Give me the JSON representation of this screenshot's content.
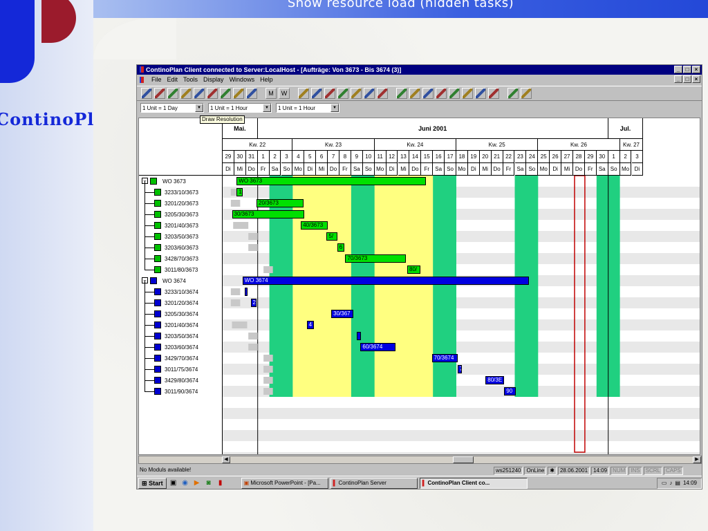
{
  "slide": {
    "title": "Show resource load (hidden tasks)",
    "logo_text": "ContinoPlan"
  },
  "window": {
    "title": "ContinoPlan Client connected to Server:LocalHost - [Aufträge: Von 3673 - Bis 3674 (3)]",
    "controls": [
      "_",
      "□",
      "×"
    ]
  },
  "menu": [
    "File",
    "Edit",
    "Tools",
    "Display",
    "Windows",
    "Help"
  ],
  "toolbar_icons": [
    "print-icon",
    "report-icon",
    "person-icon",
    "open-icon",
    "save-icon",
    "copy-icon",
    "print-preview-icon",
    "save2-icon",
    "info-icon",
    "M",
    "W",
    "gantt1-icon",
    "gantt2-icon",
    "gantt3-icon",
    "link-icon",
    "unlink-icon",
    "folder-icon",
    "move-icon",
    "shift-icon",
    "view1-icon",
    "view2-icon",
    "view3-icon",
    "edit-icon",
    "chart-icon",
    "props-icon",
    "pen-icon",
    "zoom-in-icon",
    "zoom-out-icon"
  ],
  "combos": [
    {
      "value": "1 Unit = 1 Day"
    },
    {
      "value": "1 Unit = 1 Hour"
    },
    {
      "value": "1 Unit = 1 Hour"
    }
  ],
  "tooltip": "Draw Resolution",
  "timeline": {
    "months": [
      {
        "label": "Mai."
      },
      {
        "label": "Juni 2001"
      },
      {
        "label": "Jul."
      }
    ],
    "weeks": [
      "Kw. 22",
      "Kw. 23",
      "Kw. 24",
      "Kw. 25",
      "Kw. 26",
      "Kw. 27"
    ],
    "days": [
      "29",
      "30",
      "31",
      "1",
      "2",
      "3",
      "4",
      "5",
      "6",
      "7",
      "8",
      "9",
      "10",
      "11",
      "12",
      "13",
      "14",
      "15",
      "16",
      "17",
      "18",
      "19",
      "20",
      "21",
      "22",
      "23",
      "24",
      "25",
      "26",
      "27",
      "28",
      "29",
      "30",
      "1",
      "2",
      "3"
    ],
    "weekdays": [
      "Di",
      "Mi",
      "Do",
      "Fr",
      "Sa",
      "So",
      "Mo",
      "Di",
      "Mi",
      "Do",
      "Fr",
      "Sa",
      "So",
      "Mo",
      "Di",
      "Mi",
      "Do",
      "Fr",
      "Sa",
      "So",
      "Mo",
      "Di",
      "Mi",
      "Do",
      "Fr",
      "Sa",
      "So",
      "Mo",
      "Di",
      "Mi",
      "Do",
      "Fr",
      "Sa",
      "So",
      "Mo",
      "Di"
    ]
  },
  "tree": [
    {
      "label": "WO 3673",
      "group": true,
      "color": "#00c000"
    },
    {
      "label": "3233/10/3673",
      "color": "#00c000"
    },
    {
      "label": "3201/20/3673",
      "color": "#00c000"
    },
    {
      "label": "3205/30/3673",
      "color": "#00c000"
    },
    {
      "label": "3201/40/3673",
      "color": "#00c000"
    },
    {
      "label": "3203/50/3673",
      "color": "#00c000"
    },
    {
      "label": "3203/60/3673",
      "color": "#00c000"
    },
    {
      "label": "3428/70/3673",
      "color": "#00c000"
    },
    {
      "label": "3011/80/3673",
      "color": "#00c000"
    },
    {
      "label": "WO 3674",
      "group": true,
      "color": "#0000d0"
    },
    {
      "label": "3233/10/3674",
      "color": "#0000d0"
    },
    {
      "label": "3201/20/3674",
      "color": "#0000d0"
    },
    {
      "label": "3205/30/3674",
      "color": "#0000d0"
    },
    {
      "label": "3201/40/3674",
      "color": "#0000d0"
    },
    {
      "label": "3203/50/3674",
      "color": "#0000d0"
    },
    {
      "label": "3203/60/3674",
      "color": "#0000d0"
    },
    {
      "label": "3429/70/3674",
      "color": "#0000d0"
    },
    {
      "label": "3011/75/3674",
      "color": "#0000d0"
    },
    {
      "label": "3429/80/3674",
      "color": "#0000d0"
    },
    {
      "label": "3011/90/3674",
      "color": "#0000d0"
    }
  ],
  "bars": [
    {
      "row": 0,
      "label": "WO 3673",
      "color": "#00e000"
    },
    {
      "row": 1,
      "label": "1",
      "color": "#00e000"
    },
    {
      "row": 2,
      "label": "20/3673",
      "color": "#00e000"
    },
    {
      "row": 3,
      "label": "30/3673",
      "color": "#00e000"
    },
    {
      "row": 4,
      "label": "40/3673",
      "color": "#00e000"
    },
    {
      "row": 5,
      "label": "5/",
      "color": "#00e000"
    },
    {
      "row": 6,
      "label": "6",
      "color": "#00e000"
    },
    {
      "row": 7,
      "label": "70/3673",
      "color": "#00e000"
    },
    {
      "row": 8,
      "label": "80/",
      "color": "#00e000"
    },
    {
      "row": 9,
      "label": "WO 3674",
      "color": "#0000e0"
    },
    {
      "row": 10,
      "label": "",
      "color": "#0000e0"
    },
    {
      "row": 11,
      "label": "2",
      "color": "#0000e0"
    },
    {
      "row": 12,
      "label": "30/367",
      "color": "#0000e0"
    },
    {
      "row": 13,
      "label": "4",
      "color": "#0000e0"
    },
    {
      "row": 14,
      "label": "",
      "color": "#0000e0"
    },
    {
      "row": 15,
      "label": "60/3674",
      "color": "#0000e0"
    },
    {
      "row": 16,
      "label": "70/3674",
      "color": "#0000e0"
    },
    {
      "row": 17,
      "label": "7",
      "color": "#0000e0"
    },
    {
      "row": 18,
      "label": "80/3E",
      "color": "#0000e0"
    },
    {
      "row": 19,
      "label": "90",
      "color": "#0000e0"
    }
  ],
  "status": {
    "message": "No Moduls available!",
    "user": "ws251240",
    "mode": "OnLine",
    "date": "28.06.2001",
    "time": "14:09",
    "indicators": [
      "NUM",
      "INS",
      "SCRL",
      "CAPS"
    ]
  },
  "taskbar": {
    "start": "Start",
    "tasks": [
      {
        "label": "Microsoft PowerPoint - [Pa..."
      },
      {
        "label": "ContinoPlan Server"
      },
      {
        "label": "ContinoPlan Client co...",
        "active": true
      }
    ],
    "clock": "14:09"
  },
  "colors": {
    "weekend": "#20d080",
    "week_highlight": "#ffff80",
    "light_row": "#e8e8e8"
  }
}
